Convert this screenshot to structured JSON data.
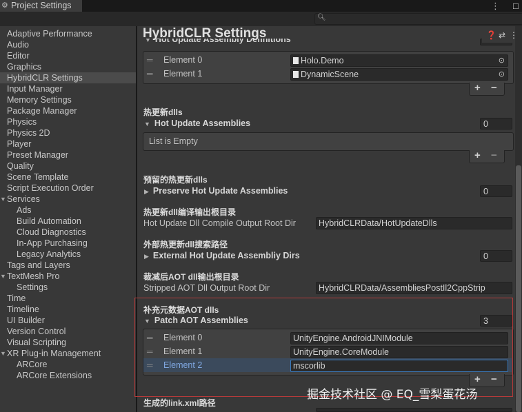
{
  "window": {
    "tab_title": "Project Settings",
    "menu_icon": "kebab-menu-icon",
    "close_icon": "close-icon"
  },
  "search": {
    "value": "",
    "icon": "search-icon"
  },
  "sidebar": {
    "items": [
      {
        "label": "Adaptive Performance"
      },
      {
        "label": "Audio"
      },
      {
        "label": "Editor"
      },
      {
        "label": "Graphics"
      },
      {
        "label": "HybridCLR Settings",
        "selected": true
      },
      {
        "label": "Input Manager"
      },
      {
        "label": "Memory Settings"
      },
      {
        "label": "Package Manager"
      },
      {
        "label": "Physics"
      },
      {
        "label": "Physics 2D"
      },
      {
        "label": "Player"
      },
      {
        "label": "Preset Manager"
      },
      {
        "label": "Quality"
      },
      {
        "label": "Scene Template"
      },
      {
        "label": "Script Execution Order"
      },
      {
        "label": "Services",
        "expanded": true
      },
      {
        "label": "Ads",
        "child": true
      },
      {
        "label": "Build Automation",
        "child": true
      },
      {
        "label": "Cloud Diagnostics",
        "child": true
      },
      {
        "label": "In-App Purchasing",
        "child": true
      },
      {
        "label": "Legacy Analytics",
        "child": true
      },
      {
        "label": "Tags and Layers"
      },
      {
        "label": "TextMesh Pro",
        "expanded": true
      },
      {
        "label": "Settings",
        "child": true
      },
      {
        "label": "Time"
      },
      {
        "label": "Timeline"
      },
      {
        "label": "UI Builder"
      },
      {
        "label": "Version Control"
      },
      {
        "label": "Visual Scripting"
      },
      {
        "label": "XR Plug-in Management",
        "expanded": true
      },
      {
        "label": "ARCore",
        "child": true
      },
      {
        "label": "ARCore Extensions",
        "child": true
      }
    ]
  },
  "header": {
    "title": "HybridCLR Settings",
    "icons": [
      "help-icon",
      "preset-icon",
      "more-icon"
    ]
  },
  "hot_update_asm_defs": {
    "label": "Hot Update Assembly Definitions",
    "count": "2",
    "elements": [
      {
        "label": "Element 0",
        "value": "Holo.Demo"
      },
      {
        "label": "Element 1",
        "value": "DynamicScene"
      }
    ]
  },
  "hot_update_dlls": {
    "section_title": "热更新dlls",
    "label": "Hot Update Assemblies",
    "count": "0",
    "empty_text": "List is Empty"
  },
  "preserve_dlls": {
    "section_title": "预留的热更新dlls",
    "label": "Preserve Hot Update Assemblies",
    "count": "0"
  },
  "compile_output": {
    "section_title": "热更新dll编译输出根目录",
    "label": "Hot Update Dll Compile Output Root Dir",
    "value": "HybridCLRData/HotUpdateDlls"
  },
  "external_dirs": {
    "section_title": "外部热更新dll搜索路径",
    "label": "External Hot Update Assembliy Dirs",
    "count": "0"
  },
  "stripped_aot": {
    "section_title": "裁减后AOT dll输出根目录",
    "label": "Stripped AOT Dll Output Root Dir",
    "value": "HybridCLRData/AssembliesPostIl2CppStrip"
  },
  "patch_aot": {
    "section_title": "补充元数据AOT dlls",
    "label": "Patch AOT Assemblies",
    "count": "3",
    "elements": [
      {
        "label": "Element 0",
        "value": "UnityEngine.AndroidJNIModule"
      },
      {
        "label": "Element 1",
        "value": "UnityEngine.CoreModule"
      },
      {
        "label": "Element 2",
        "value": "mscorlib"
      }
    ]
  },
  "link_xml": {
    "section_title": "生成的link.xml路径"
  },
  "list_buttons": {
    "add": "+",
    "remove": "−"
  },
  "watermark": "掘金技术社区 @ EQ_雪梨蛋花汤",
  "colors": {
    "accent_blue": "#3a79bb",
    "highlight_red": "#b53a3a",
    "selected_text": "#7fa7e0"
  }
}
